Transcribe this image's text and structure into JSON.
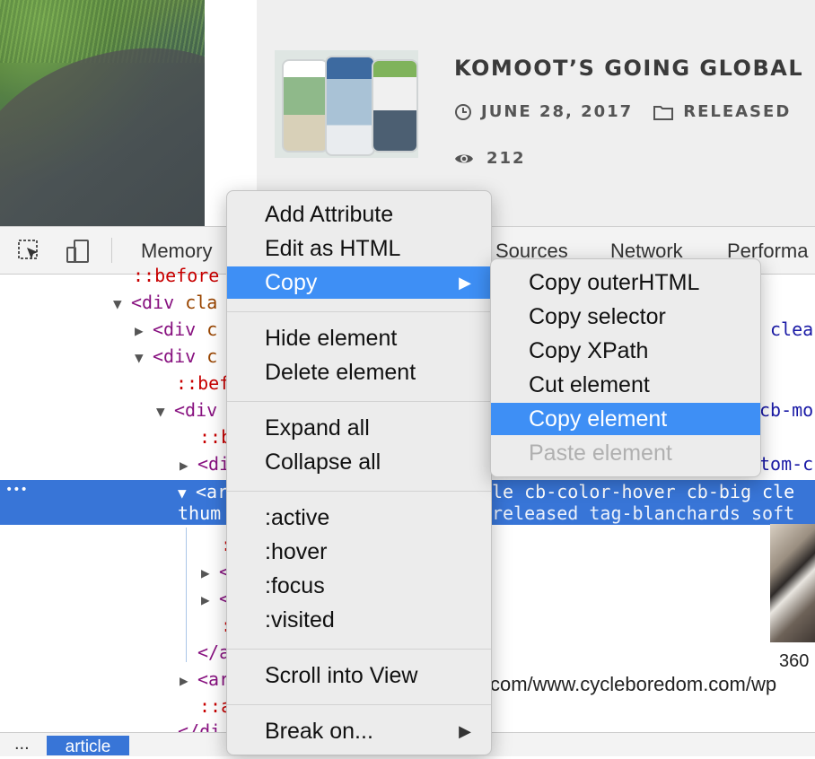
{
  "page": {
    "post_title": "KOMOOT’S GOING GLOBAL",
    "date": "JUNE 28, 2017",
    "category": "RELEASED",
    "views": "212"
  },
  "devtools": {
    "tabs": [
      "Memory",
      "Sources",
      "Network",
      "Performa"
    ],
    "code_lines": [
      {
        "text": "::before"
      },
      {
        "tag": "<div",
        "attr": " cla"
      },
      {
        "tag": "<div",
        "attr": " c"
      },
      {
        "tag": "<div",
        "attr": " c"
      },
      {
        "pseudo": "::bef"
      },
      {
        "tag": "<div"
      },
      {
        "pseudo": "::b"
      },
      {
        "tag": "<di"
      },
      {
        "sel1": "<ar",
        "sel1_tail": "le cb-color-hover cb-big cle",
        "sel2": "thum",
        "sel2_tail": "released tag-blanchards soft"
      },
      {
        "tag": "</a"
      },
      {
        "tag": "<ar"
      },
      {
        "pseudo": "::a"
      },
      {
        "tag": "</di"
      }
    ],
    "right_fragments": {
      "clea": "clea",
      "cb_mo": "cb-mo",
      "tom_c": "tom-c"
    },
    "dots": "•••",
    "image_dim": "360",
    "url_text": "com/www.cycleboredom.com/wp",
    "breadcrumb_dots": "...",
    "breadcrumb_active": "article"
  },
  "context_menu": {
    "items": [
      {
        "label": "Add Attribute"
      },
      {
        "label": "Edit as HTML"
      },
      {
        "label": "Copy",
        "submenu": true,
        "active": true
      },
      {
        "label": "Hide element"
      },
      {
        "label": "Delete element"
      },
      {
        "label": "Expand all"
      },
      {
        "label": "Collapse all"
      },
      {
        "label": ":active"
      },
      {
        "label": ":hover"
      },
      {
        "label": ":focus"
      },
      {
        "label": ":visited"
      },
      {
        "label": "Scroll into View"
      },
      {
        "label": "Break on...",
        "submenu": true
      }
    ],
    "arrow": "▶"
  },
  "copy_submenu": {
    "items": [
      {
        "label": "Copy outerHTML"
      },
      {
        "label": "Copy selector"
      },
      {
        "label": "Copy XPath"
      },
      {
        "label": "Cut element"
      },
      {
        "label": "Copy element",
        "active": true
      },
      {
        "label": "Paste element",
        "disabled": true
      }
    ]
  },
  "colors": {
    "menu_highlight": "#3e8ff5",
    "selection_row": "#3875d7"
  }
}
